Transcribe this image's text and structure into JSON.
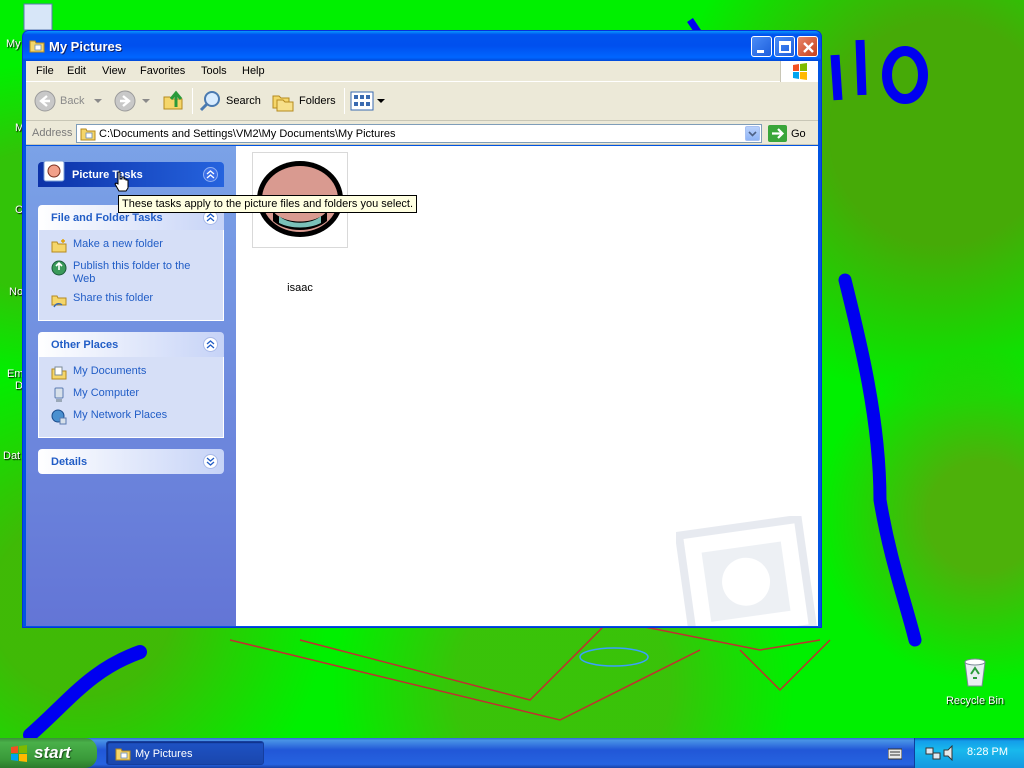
{
  "desktop": {
    "left_icon_fragments": [
      "My",
      "M",
      "C",
      "No",
      "Em",
      "D",
      "Dat"
    ],
    "recycle_bin_label": "Recycle Bin"
  },
  "window": {
    "title": "My Pictures",
    "menu": [
      "File",
      "Edit",
      "View",
      "Favorites",
      "Tools",
      "Help"
    ],
    "toolbar": {
      "back_label": "Back",
      "search_label": "Search",
      "folders_label": "Folders"
    },
    "address": {
      "label": "Address",
      "value": "C:\\Documents and Settings\\VM2\\My Documents\\My Pictures",
      "go_label": "Go"
    },
    "left_pane": {
      "picture_tasks_title": "Picture Tasks",
      "file_folder_tasks": {
        "title": "File and Folder Tasks",
        "items": [
          "Make a new folder",
          "Publish this folder to the Web",
          "Share this folder"
        ]
      },
      "other_places": {
        "title": "Other Places",
        "items": [
          "My Documents",
          "My Computer",
          "My Network Places"
        ]
      },
      "details_title": "Details"
    },
    "files": [
      {
        "name": "isaac",
        "type": "image"
      }
    ],
    "tooltip": "These tasks apply to the picture files and folders you select."
  },
  "taskbar": {
    "start_label": "start",
    "task_label": "My Pictures",
    "clock": "8:28 PM"
  },
  "colors": {
    "desktop_green": "#00f000",
    "window_blue": "#0054e3",
    "task_link": "#215dc6",
    "drawn_blue": "#0000f0"
  }
}
